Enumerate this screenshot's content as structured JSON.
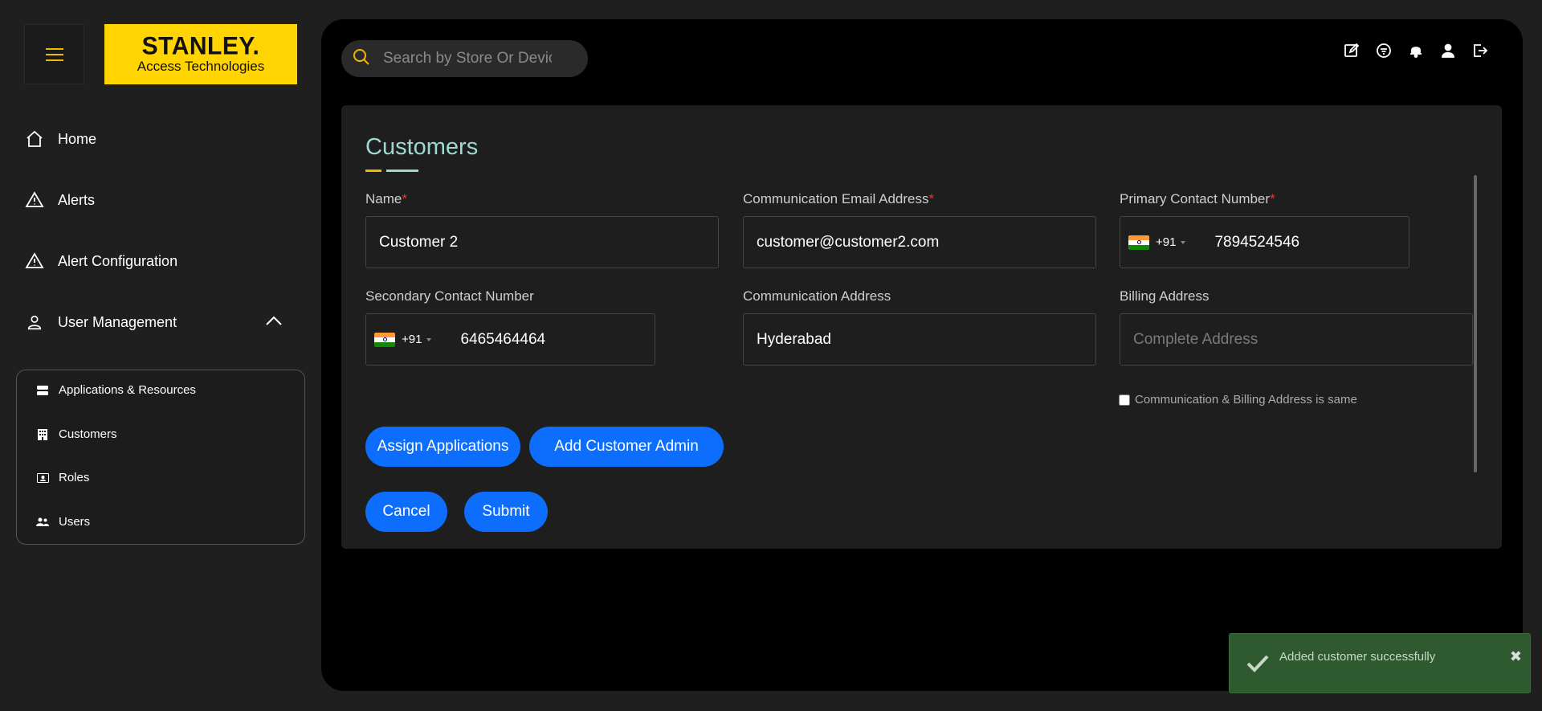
{
  "brand": {
    "name": "STANLEY.",
    "tagline": "Access Technologies"
  },
  "sidebar": {
    "items": [
      {
        "label": "Home",
        "icon": "home-icon"
      },
      {
        "label": "Alerts",
        "icon": "warning-icon"
      },
      {
        "label": "Alert Configuration",
        "icon": "warning-icon"
      },
      {
        "label": "User Management",
        "icon": "user-icon"
      }
    ],
    "submenu": [
      {
        "label": "Applications & Resources",
        "icon": "server-icon"
      },
      {
        "label": "Customers",
        "icon": "building-icon"
      },
      {
        "label": "Roles",
        "icon": "id-card-icon"
      },
      {
        "label": "Users",
        "icon": "users-icon"
      }
    ]
  },
  "header": {
    "search_placeholder": "Search by Store Or Device",
    "icons": [
      "edit-icon",
      "filter-icon",
      "bell-icon",
      "user-icon",
      "logout-icon"
    ]
  },
  "form": {
    "title": "Customers",
    "name": {
      "label": "Name",
      "required": "*",
      "value": "Customer 2"
    },
    "email": {
      "label": "Communication Email Address",
      "required": "*",
      "value": "customer@customer2.com"
    },
    "primary_contact": {
      "label": "Primary Contact Number",
      "required": "*",
      "country_code": "+91",
      "value": "7894524546"
    },
    "secondary_contact": {
      "label": "Secondary Contact Number",
      "country_code": "+91",
      "value": "6465464464"
    },
    "comm_address": {
      "label": "Communication Address",
      "value": "Hyderabad"
    },
    "billing_address": {
      "label": "Billing Address",
      "placeholder": "Complete Address"
    },
    "same_address_label": "Communication & Billing Address is same",
    "buttons": {
      "assign_applications": "Assign Applications",
      "add_customer_admin": "Add Customer Admin",
      "cancel": "Cancel",
      "submit": "Submit"
    }
  },
  "toast": {
    "message": "Added customer successfully",
    "close": "✖"
  },
  "colors": {
    "accent": "#0d6efd",
    "brand_yellow": "#ffd400",
    "title": "#9fd8d1",
    "toast_bg": "#2f5a2f"
  }
}
